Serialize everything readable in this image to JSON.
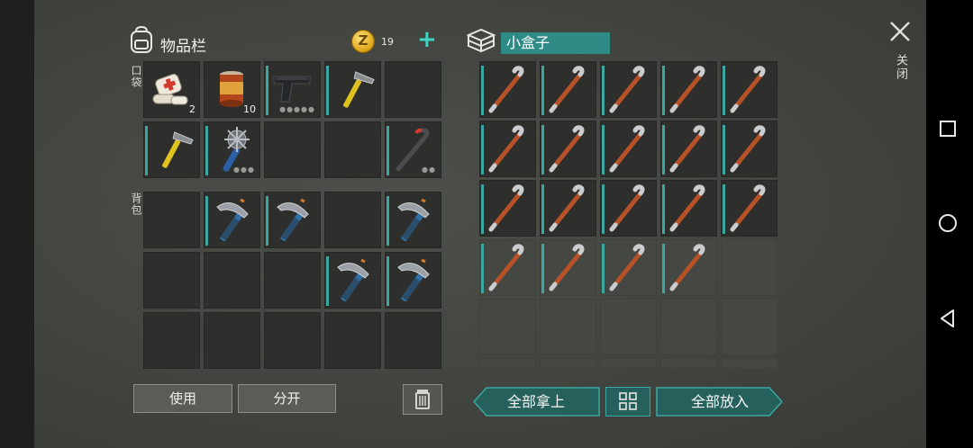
{
  "inventory": {
    "title": "物品栏",
    "coins": "19",
    "pocket_label": "口袋",
    "backpack_label": "背包",
    "pocket": [
      {
        "item": "bandage",
        "qty": "2"
      },
      {
        "item": "canned-food",
        "qty": "10"
      },
      {
        "item": "pistol",
        "dots": "●●●●●"
      },
      {
        "item": "hammer"
      },
      {
        "item": ""
      },
      {
        "item": "hammer"
      },
      {
        "item": "spiked-club",
        "dots": "●●●"
      },
      {
        "item": ""
      },
      {
        "item": ""
      },
      {
        "item": "crowbar-dark",
        "dots": "●●"
      }
    ],
    "backpack": [
      {
        "item": ""
      },
      {
        "item": "pickaxe"
      },
      {
        "item": "pickaxe"
      },
      {
        "item": ""
      },
      {
        "item": "pickaxe"
      },
      {
        "item": ""
      },
      {
        "item": ""
      },
      {
        "item": ""
      },
      {
        "item": "pickaxe"
      },
      {
        "item": "pickaxe"
      },
      {
        "item": ""
      },
      {
        "item": ""
      },
      {
        "item": ""
      },
      {
        "item": ""
      },
      {
        "item": ""
      }
    ],
    "use_label": "使用",
    "split_label": "分开"
  },
  "container": {
    "title": "小盒子",
    "crowbar_count": 19,
    "take_all_label": "全部拿上",
    "put_all_label": "全部放入"
  },
  "close_label": "关闭",
  "colors": {
    "accent": "#3aa7a0",
    "title_bg": "#2f8b86",
    "plus": "#3ed6c3"
  },
  "icons": [
    "backpack-icon",
    "coin-icon",
    "box-icon",
    "trash-icon",
    "grid-icon",
    "close-icon"
  ]
}
